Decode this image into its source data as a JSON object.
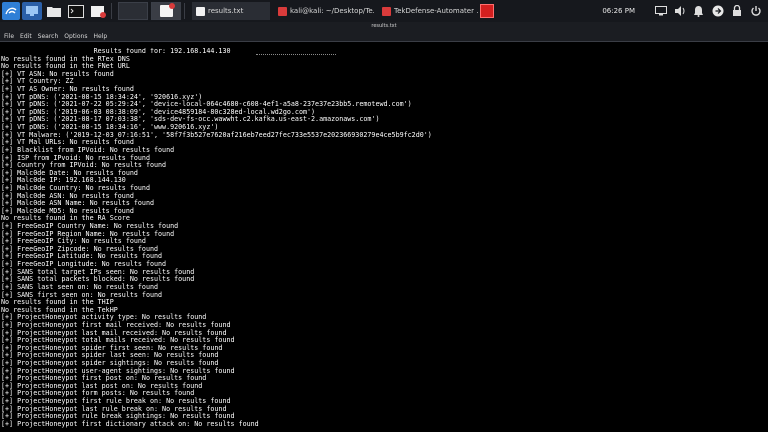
{
  "taskbar": {
    "launchers": [
      {
        "name": "kali-menu-icon"
      },
      {
        "name": "desktop-icon"
      },
      {
        "name": "file-manager-icon"
      },
      {
        "name": "terminal-icon"
      },
      {
        "name": "screenshot-icon"
      }
    ],
    "windows": [
      {
        "title": "results.txt",
        "icon_color": "#f2f2f2"
      },
      {
        "title": "kali@kali: ~/Desktop/Te...",
        "icon_color": "#d93b3b"
      },
      {
        "title": "TekDefense-Automater ...",
        "icon_color": "#d93b3b"
      }
    ],
    "clock": "06:26 PM",
    "accent": "#2f7fd6"
  },
  "window": {
    "title": "results.txt",
    "menu": [
      "File",
      "Edit",
      "Search",
      "Options",
      "Help"
    ]
  },
  "content": {
    "lines": [
      "                       Results found for: 192.168.144.130",
      "No results found in the RTex DNS",
      "No results found in the FNet URL",
      "[+] VT ASN: No results found",
      "[+] VT Country: ZZ",
      "[+] VT AS Owner: No results found",
      "[+] VT pDNS: ('2021-08-15 18:34:24', '920616.xyz')",
      "[+] VT pDNS: ('2021-07-22 05:29:24', 'device-local-064c4680-c608-4ef1-a5a8-237e37e23bb5.remotewd.com')",
      "[+] VT pDNS: ('2019-06-03 08:38:09', 'device4859184-80c328ed-local.wd2go.com')",
      "[+] VT pDNS: ('2021-08-17 07:03:38', 'sds-dev-fs-occ.wawwht.c2.kafka.us-east-2.amazonaws.com')",
      "[+] VT pDNS: ('2021-08-15 18:34:16', 'www.920616.xyz')",
      "[+] VT Malware: ('2019-12-03 07:16:51', '58f7f3b527e7620af216eb7eed27fec733e5537e202366930279e4ce5b9fc2d0')",
      "[+] VT Mal URLs: No results found",
      "[+] Blacklist from IPVoid: No results found",
      "[+] ISP from IPvoid: No results found",
      "[+] Country from IPVoid: No results found",
      "[+] Malc0de Date: No results found",
      "[+] Malc0de IP: 192.168.144.130",
      "[+] Malc0de Country: No results found",
      "[+] Malc0de ASN: No results found",
      "[+] Malc0de ASN Name: No results found",
      "[+] Malc0de MD5: No results found",
      "No results found in the RA Score",
      "[+] FreeGeoIP Country Name: No results found",
      "[+] FreeGeoIP Region Name: No results found",
      "[+] FreeGeoIP City: No results found",
      "[+] FreeGeoIP Zipcode: No results found",
      "[+] FreeGeoIP Latitude: No results found",
      "[+] FreeGeoIP Longitude: No results found",
      "[+] SANS total target IPs seen: No results found",
      "[+] SANS total packets blocked: No results found",
      "[+] SANS last seen on: No results found",
      "[+] SANS first seen on: No results found",
      "No results found in the THIP",
      "No results found in the TekHP",
      "[+] ProjectHoneypot activity type: No results found",
      "[+] ProjectHoneypot first mail received: No results found",
      "[+] ProjectHoneypot last mail received: No results found",
      "[+] ProjectHoneypot total mails received: No results found",
      "[+] ProjectHoneypot spider first seen: No results found",
      "[+] ProjectHoneypot spider last seen: No results found",
      "[+] ProjectHoneypot spider sightings: No results found",
      "[+] ProjectHoneypot user-agent sightings: No results found",
      "[+] ProjectHoneypot first post on: No results found",
      "[+] ProjectHoneypot last post on: No results found",
      "[+] ProjectHoneypot form posts: No results found",
      "[+] ProjectHoneypot first rule break on: No results found",
      "[+] ProjectHoneypot last rule break on: No results found",
      "[+] ProjectHoneypot rule break sightings: No results found",
      "[+] ProjectHoneypot first dictionary attack on: No results found"
    ]
  }
}
